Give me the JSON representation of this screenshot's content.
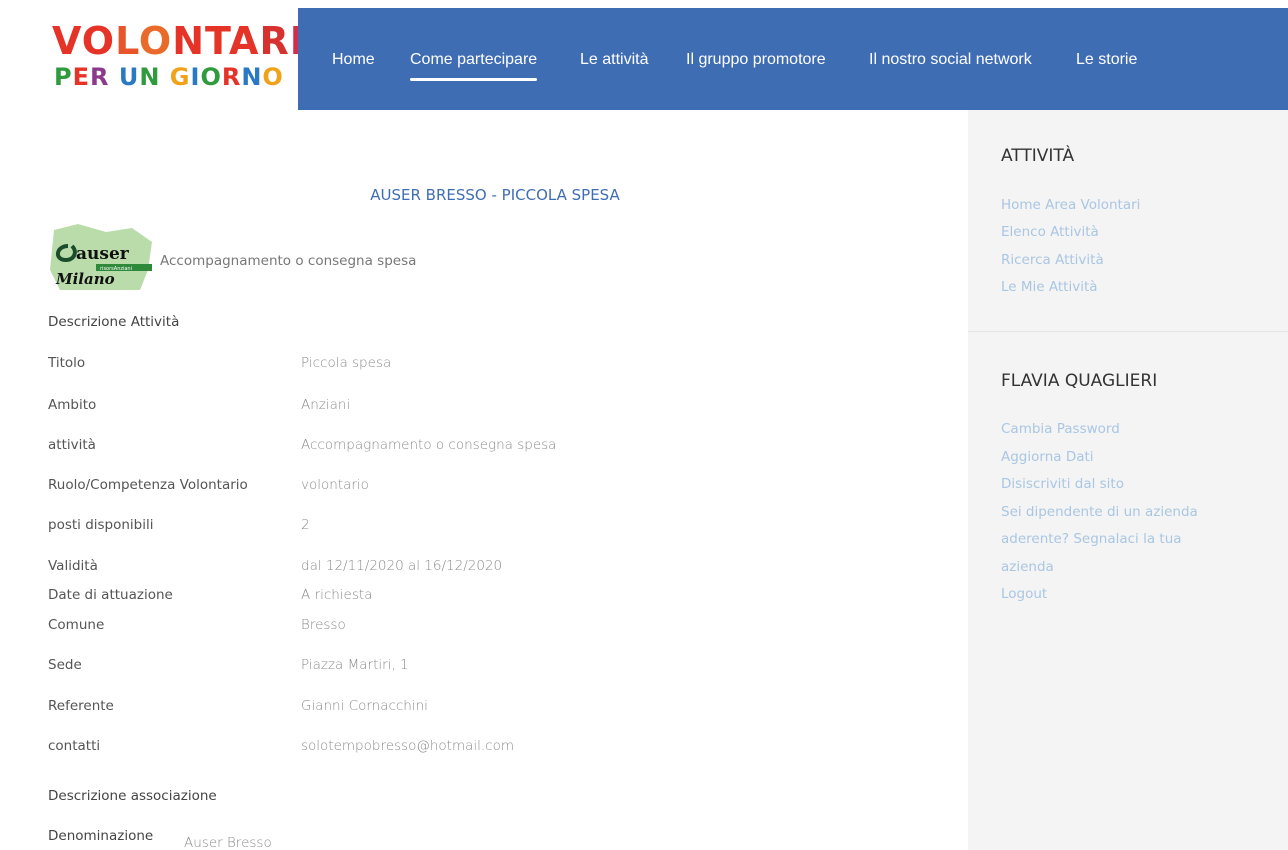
{
  "header": {
    "logo_line1": "VOLONTARI",
    "logo_line2": "PER UN GIORNO",
    "nav": [
      {
        "label": "Home"
      },
      {
        "label": "Come partecipare",
        "active": true
      },
      {
        "label": "Le attività"
      },
      {
        "label": "Il gruppo promotore"
      },
      {
        "label": "Il nostro social network"
      },
      {
        "label": "Le storie"
      }
    ],
    "nav_color": "#3f6db4"
  },
  "activity": {
    "title": "AUSER BRESSO - PICCOLA SPESA",
    "logo_text_1": "auser",
    "logo_text_2": "risorsAnziani",
    "logo_text_3": "Milano",
    "category": "Accompagnamento o consegna spesa",
    "section_description": "Descrizione Attività",
    "rows": [
      {
        "label": "Titolo",
        "value": "Piccola spesa"
      },
      {
        "label": "Ambito",
        "value": "Anziani"
      },
      {
        "label": "attività",
        "value": "Accompagnamento o consegna spesa"
      },
      {
        "label": "Ruolo/Competenza Volontario",
        "value": "volontario"
      },
      {
        "label": "posti disponibili",
        "value": "2"
      },
      {
        "label": "Validità",
        "value": "dal 12/11/2020 al 16/12/2020"
      },
      {
        "label": "Date di attuazione",
        "value": "A richiesta"
      },
      {
        "label": "Comune",
        "value": "Bresso"
      },
      {
        "label": "Sede",
        "value": "Piazza Martiri, 1"
      },
      {
        "label": "Referente",
        "value": "Gianni Cornacchini"
      },
      {
        "label": "contatti",
        "value": "solotempobresso@hotmail.com"
      }
    ],
    "section_association": "Descrizione associazione",
    "denominazione_label": "Denominazione",
    "denominazione_value": "Auser Bresso"
  },
  "sidebar": {
    "activities_heading": "ATTIVITÀ",
    "activities_links": [
      "Home Area Volontari",
      "Elenco Attività",
      "Ricerca Attività",
      "Le Mie Attività"
    ],
    "user_heading": "FLAVIA QUAGLIERI",
    "user_links": [
      "Cambia Password",
      "Aggiorna Dati",
      "Disiscriviti dal sito",
      "Sei dipendente di un azienda",
      "aderente? Segnalaci la tua",
      "azienda",
      "Logout"
    ],
    "link_color": "#a9c6e3"
  }
}
